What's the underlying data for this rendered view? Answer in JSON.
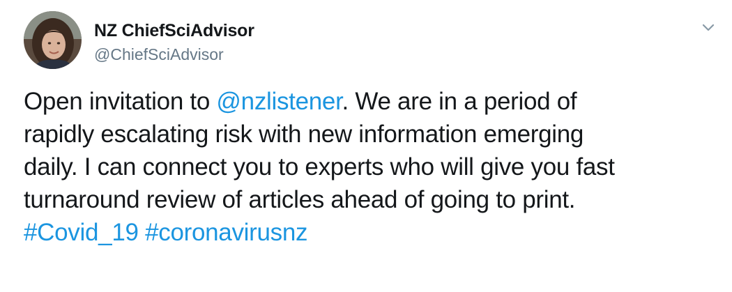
{
  "author": {
    "name": "NZ ChiefSciAdvisor",
    "handle": "@ChiefSciAdvisor"
  },
  "tweet": {
    "line1": {
      "before": "Open invitation to ",
      "mention": "@nzlistener",
      "after": ".  We are in a period of"
    },
    "line2": "rapidly escalating risk with new information emerging",
    "line3": "daily. I can connect you to experts who will give you fast",
    "line4": "turnaround review of articles ahead of going to print.",
    "hashtags": [
      "#Covid_19",
      "#coronavirusnz"
    ]
  },
  "colors": {
    "text": "#14171a",
    "secondary": "#657786",
    "link": "#1b95e0",
    "background": "#ffffff"
  },
  "icons": {
    "menu": "chevron-down-icon"
  }
}
